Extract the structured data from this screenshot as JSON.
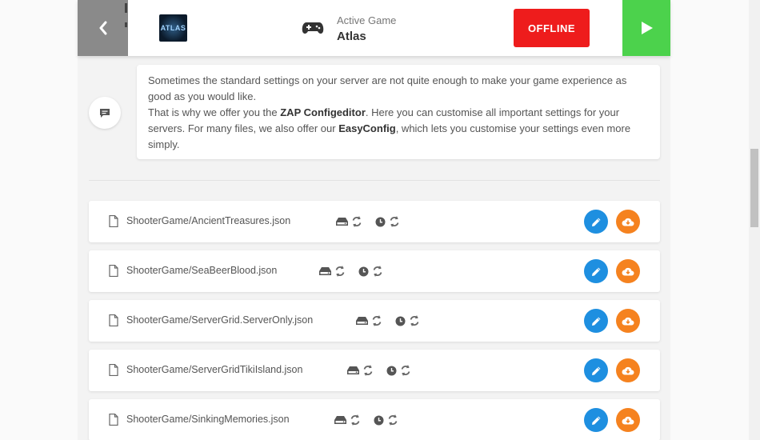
{
  "header": {
    "logo_text": "ATLAS",
    "active_label": "Active Game",
    "game_name": "Atlas",
    "status_label": "OFFLINE"
  },
  "info": {
    "line1": "Sometimes the standard settings on your server are not quite enough to make your game experience as good as you would like.",
    "line2_pre": "That is why we offer you the ",
    "line2_bold": "ZAP Configeditor",
    "line2_post": ". Here you can customise all important settings for your servers. For many files, we also offer our ",
    "line2_bold2": "EasyConfig",
    "line2_end": ", which lets you customise your settings even more simply."
  },
  "files": [
    {
      "name": "ShooterGame/AncientTreasures.json"
    },
    {
      "name": "ShooterGame/SeaBeerBlood.json"
    },
    {
      "name": "ShooterGame/ServerGrid.ServerOnly.json"
    },
    {
      "name": "ShooterGame/ServerGridTikiIsland.json"
    },
    {
      "name": "ShooterGame/SinkingMemories.json"
    }
  ],
  "icons": {
    "back": "chevron-left-icon",
    "gamepad": "gamepad-icon",
    "play": "play-icon",
    "comment": "comment-icon",
    "file": "file-icon",
    "drive": "hdd-icon",
    "sync": "sync-icon",
    "clock": "clock-icon",
    "edit": "pencil-icon",
    "download": "cloud-download-icon"
  },
  "colors": {
    "offline": "#ee1c1c",
    "play": "#4cd24c",
    "edit": "#1e8fe0",
    "download": "#f5821f"
  }
}
